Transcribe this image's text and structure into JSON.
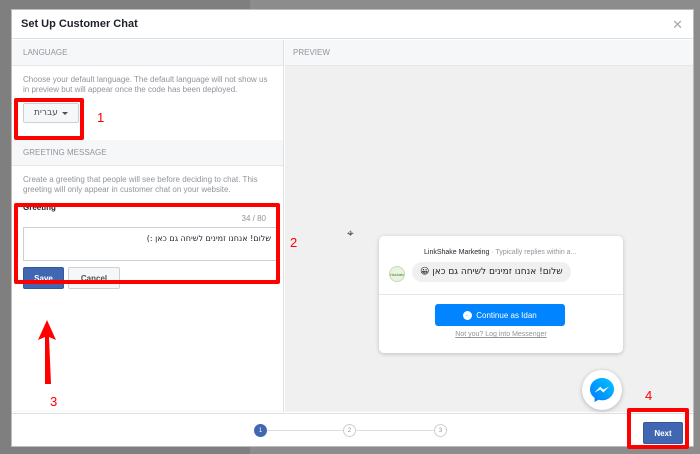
{
  "dialog": {
    "title": "Set Up Customer Chat",
    "close_icon": "close-icon"
  },
  "language": {
    "header": "LANGUAGE",
    "description": "Choose your default language. The default language will not show us in preview but will appear once the code has been deployed.",
    "selected": "עברית"
  },
  "greeting": {
    "header": "GREETING MESSAGE",
    "description": "Create a greeting that people will see before deciding to chat. This greeting will only appear in customer chat on your website.",
    "label": "Greeting",
    "counter": "34 / 80",
    "value": "שלום! אנחנו זמינים לשיחה גם כאן :)",
    "save_label": "Save",
    "cancel_label": "Cancel"
  },
  "preview": {
    "header": "PREVIEW",
    "page_name": "LinkShake Marketing",
    "subtitle": " · Typically replies within a...",
    "avatar_text": "linkshake",
    "bubble_text": "שלום! אנחנו זמינים לשיחה גם כאן 😀",
    "continue_label": "Continue as Idan",
    "not_you_label": "Not you? Log into Messenger"
  },
  "footer": {
    "steps": [
      "1",
      "2",
      "3"
    ],
    "active_step": 1,
    "next_label": "Next"
  },
  "annotations": [
    "1",
    "2",
    "3",
    "4"
  ],
  "colors": {
    "accent": "#4267b2",
    "messenger": "#0084ff",
    "highlight": "#ff0000"
  }
}
